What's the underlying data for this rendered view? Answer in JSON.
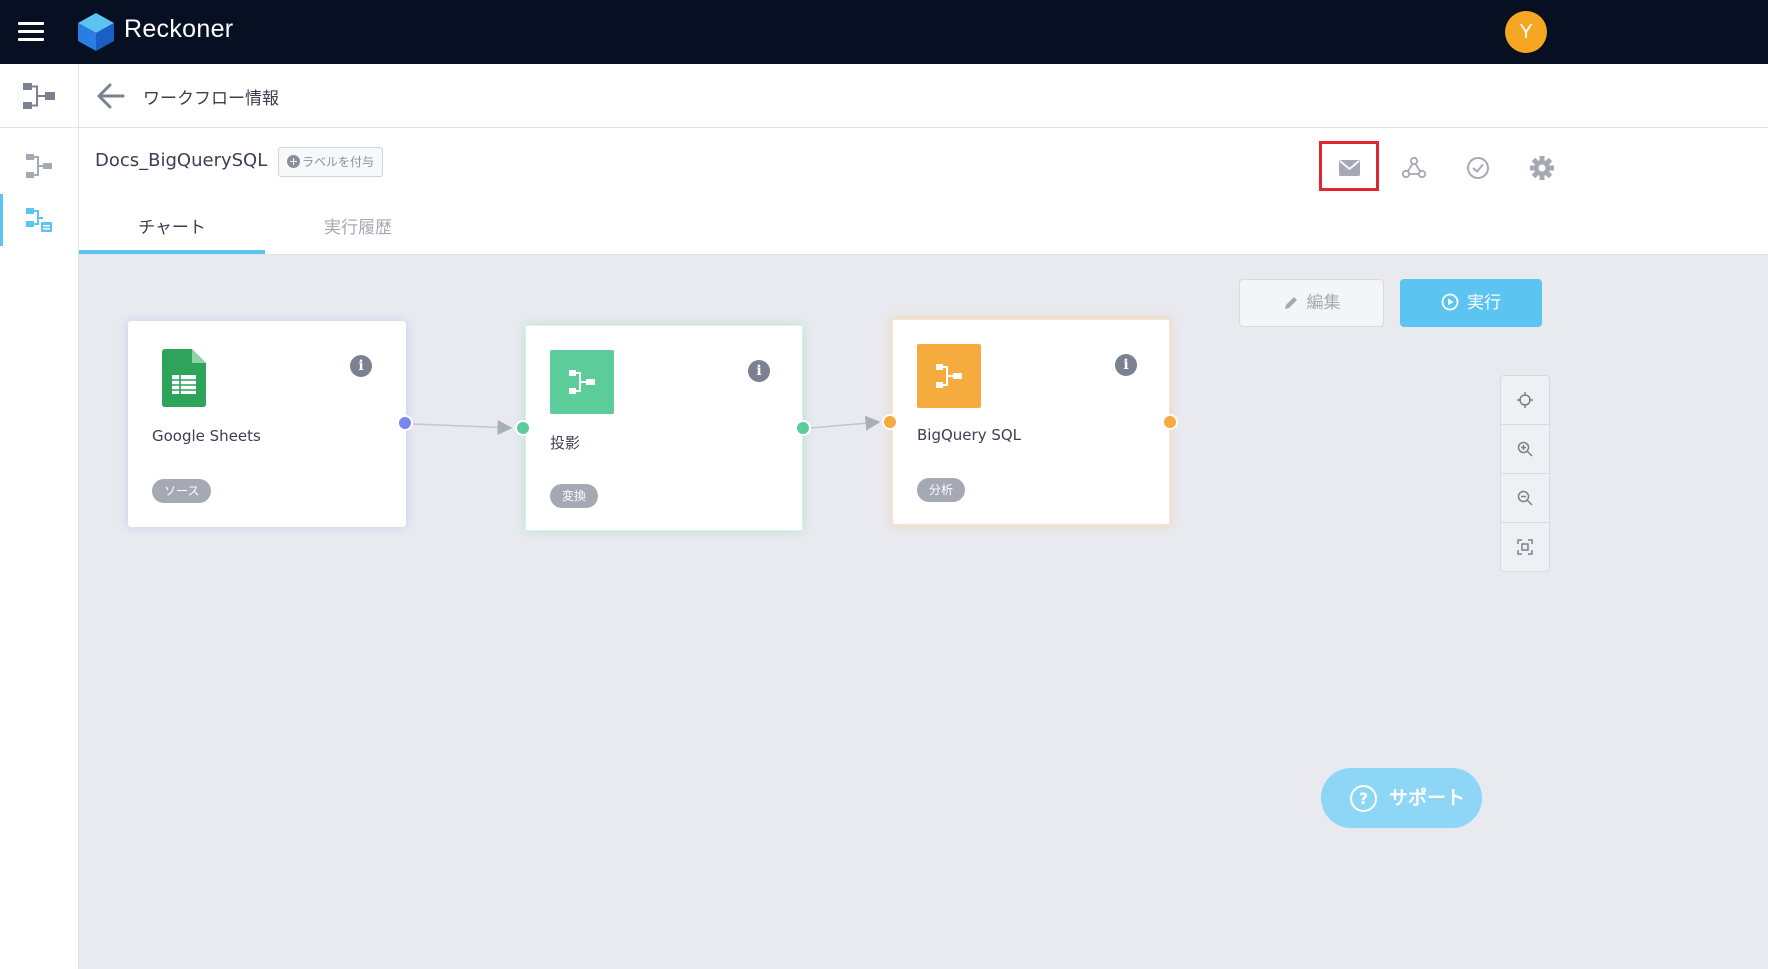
{
  "app": {
    "name": "Reckoner",
    "user_initial": "Y"
  },
  "subheader": {
    "title": "ワークフロー情報"
  },
  "workflow": {
    "name": "Docs_BigQuerySQL",
    "add_label": "ラベルを付与",
    "tabs": [
      {
        "label": "チャート",
        "active": true
      },
      {
        "label": "実行履歴",
        "active": false
      }
    ],
    "header_icons": [
      "mail-icon",
      "webhook-icon",
      "schedule-icon",
      "gear-icon"
    ]
  },
  "toolbar": {
    "edit_label": "編集",
    "run_label": "実行"
  },
  "nodes": [
    {
      "title": "Google Sheets",
      "tag": "ソース",
      "icon": "google-sheets-icon",
      "color": "#7b86f5"
    },
    {
      "title": "投影",
      "tag": "変換",
      "icon": "transform-icon",
      "color": "#5ccc9b"
    },
    {
      "title": "BigQuery SQL",
      "tag": "分析",
      "icon": "analysis-icon",
      "color": "#f5ab3d"
    }
  ],
  "zoom_controls": [
    "center-icon",
    "zoom-in-icon",
    "zoom-out-icon",
    "fit-icon"
  ],
  "support": {
    "label": "サポート"
  },
  "colors": {
    "topbar": "#061022",
    "accent": "#5bc4f0",
    "avatar": "#f5a623",
    "highlight": "#e0262f"
  }
}
